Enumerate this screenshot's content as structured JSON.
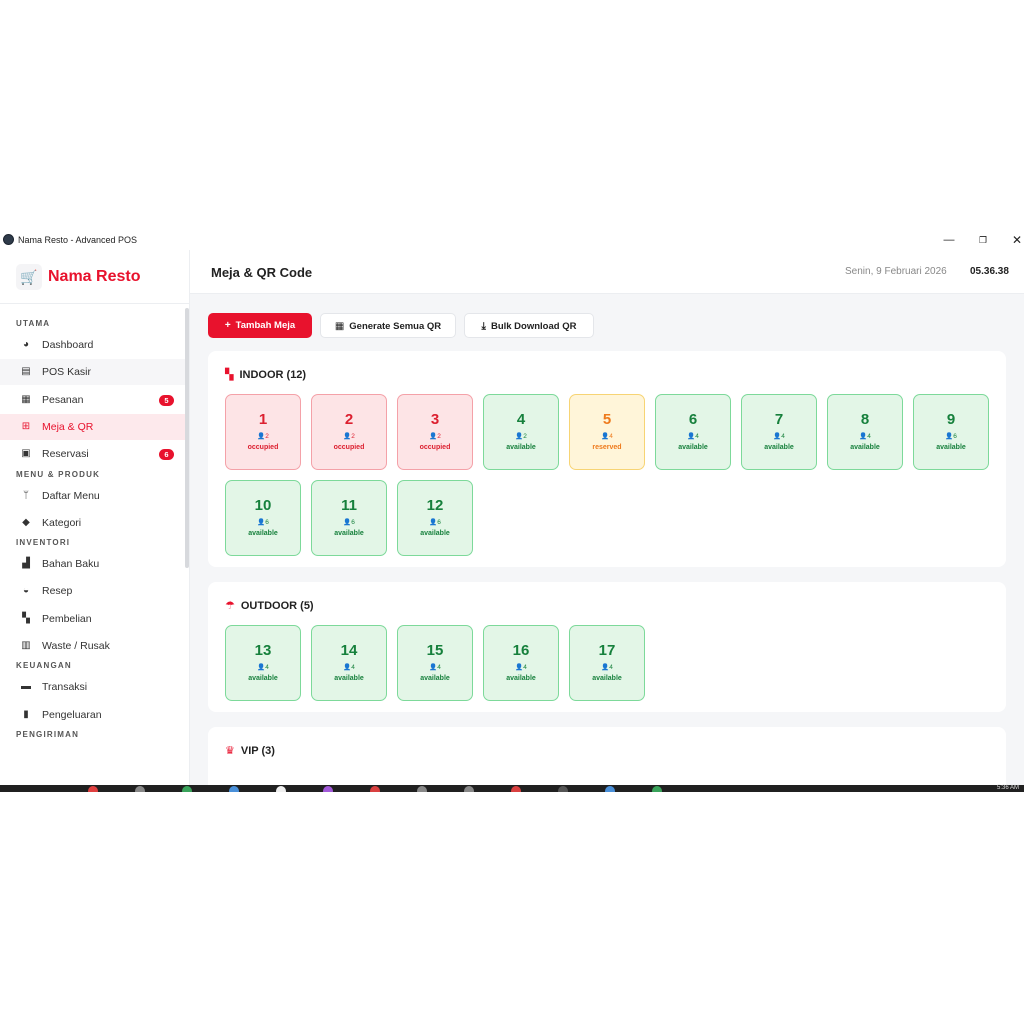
{
  "window": {
    "title": "Nama Resto - Advanced POS",
    "min_glyph": "—",
    "max_glyph": "❐",
    "close_glyph": "✕"
  },
  "brand": {
    "name": "Nama Resto",
    "logo_icon": "🛒"
  },
  "sidebar": {
    "sections": [
      {
        "label": "UTAMA",
        "items": [
          {
            "label": "Dashboard",
            "icon": "pie-chart-icon",
            "glyph": "◕"
          },
          {
            "label": "POS Kasir",
            "icon": "cash-register-icon",
            "glyph": "▤"
          },
          {
            "label": "Pesanan",
            "icon": "receipt-icon",
            "glyph": "▦",
            "badge": "5"
          },
          {
            "label": "Meja & QR",
            "icon": "grid-icon",
            "glyph": "⊞",
            "active": true
          },
          {
            "label": "Reservasi",
            "icon": "calendar-check-icon",
            "glyph": "▣",
            "badge": "6"
          }
        ]
      },
      {
        "label": "MENU & PRODUK",
        "items": [
          {
            "label": "Daftar Menu",
            "icon": "utensils-icon",
            "glyph": "ᛘ"
          },
          {
            "label": "Kategori",
            "icon": "tag-icon",
            "glyph": "◆"
          }
        ]
      },
      {
        "label": "INVENTORI",
        "items": [
          {
            "label": "Bahan Baku",
            "icon": "boxes-icon",
            "glyph": "▟"
          },
          {
            "label": "Resep",
            "icon": "mortar-icon",
            "glyph": "◒"
          },
          {
            "label": "Pembelian",
            "icon": "truck-icon",
            "glyph": "▚"
          },
          {
            "label": "Waste / Rusak",
            "icon": "trash-icon",
            "glyph": "▥"
          }
        ]
      },
      {
        "label": "KEUANGAN",
        "items": [
          {
            "label": "Transaksi",
            "icon": "money-icon",
            "glyph": "▬"
          },
          {
            "label": "Pengeluaran",
            "icon": "invoice-icon",
            "glyph": "▮"
          }
        ]
      },
      {
        "label": "PENGIRIMAN",
        "items": []
      }
    ]
  },
  "header": {
    "title": "Meja & QR Code",
    "date": "Senin, 9 Februari 2026",
    "time": "05.36.38"
  },
  "toolbar": {
    "add_label": "Tambah Meja",
    "add_glyph": "+",
    "generate_label": "Generate Semua QR",
    "generate_glyph": "▦",
    "download_label": "Bulk Download QR",
    "download_glyph": "⤓"
  },
  "areas": [
    {
      "name": "INDOOR (12)",
      "icon": "door-icon",
      "glyph": "▚",
      "tables": [
        {
          "number": "1",
          "capacity": "2",
          "status": "occupied"
        },
        {
          "number": "2",
          "capacity": "2",
          "status": "occupied"
        },
        {
          "number": "3",
          "capacity": "2",
          "status": "occupied"
        },
        {
          "number": "4",
          "capacity": "2",
          "status": "available"
        },
        {
          "number": "5",
          "capacity": "4",
          "status": "reserved"
        },
        {
          "number": "6",
          "capacity": "4",
          "status": "available"
        },
        {
          "number": "7",
          "capacity": "4",
          "status": "available"
        },
        {
          "number": "8",
          "capacity": "4",
          "status": "available"
        },
        {
          "number": "9",
          "capacity": "6",
          "status": "available"
        },
        {
          "number": "10",
          "capacity": "6",
          "status": "available"
        },
        {
          "number": "11",
          "capacity": "6",
          "status": "available"
        },
        {
          "number": "12",
          "capacity": "6",
          "status": "available"
        }
      ]
    },
    {
      "name": "OUTDOOR (5)",
      "icon": "umbrella-icon",
      "glyph": "☂",
      "tables": [
        {
          "number": "13",
          "capacity": "4",
          "status": "available"
        },
        {
          "number": "14",
          "capacity": "4",
          "status": "available"
        },
        {
          "number": "15",
          "capacity": "4",
          "status": "available"
        },
        {
          "number": "16",
          "capacity": "4",
          "status": "available"
        },
        {
          "number": "17",
          "capacity": "4",
          "status": "available"
        }
      ]
    },
    {
      "name": "VIP (3)",
      "icon": "crown-icon",
      "glyph": "♛",
      "tables": []
    }
  ],
  "capacity_glyph": "👤",
  "colors": {
    "accent": "#e8122d",
    "available": "#16803c",
    "occupied": "#dc2030",
    "reserved": "#ee7a1c"
  },
  "taskbar": {
    "clock": "5:36 AM"
  }
}
